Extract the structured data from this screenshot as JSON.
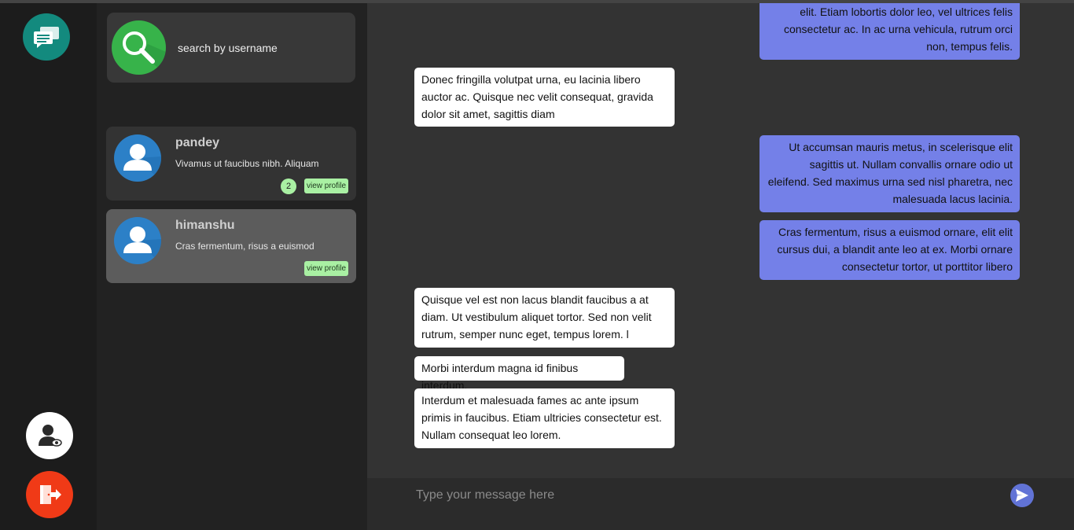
{
  "colors": {
    "accent_teal": "#138a7e",
    "search_green": "#37b34a",
    "avatar_blue": "#2c80c7",
    "badge_green": "#a9f0a3",
    "outgoing_bubble": "#7480e8",
    "logout_red": "#f03a17",
    "send_button": "#6173d6"
  },
  "rail": {
    "chat_icon": "chat-bubbles-icon",
    "profile_icon": "user-view-icon",
    "logout_icon": "logout-door-icon"
  },
  "search": {
    "placeholder": "search by username",
    "icon": "search-icon"
  },
  "contacts": [
    {
      "name": "pandey",
      "last_message": "Vivamus ut faucibus nibh. Aliquam",
      "unread": "2",
      "view_label": "view profile",
      "active": false
    },
    {
      "name": "himanshu",
      "last_message": "Cras fermentum, risus a euismod",
      "unread": "",
      "view_label": "view profile",
      "active": true
    }
  ],
  "messages": [
    {
      "direction": "out",
      "text": "elit. Etiam lobortis dolor leo, vel ultrices felis consectetur ac. In ac urna vehicula, rutrum orci non, tempus felis."
    },
    {
      "direction": "in",
      "text": "Donec fringilla volutpat urna, eu lacinia libero auctor ac. Quisque nec velit consequat, gravida dolor sit amet, sagittis diam"
    },
    {
      "direction": "out",
      "text": "Ut accumsan mauris metus, in scelerisque elit sagittis ut. Nullam convallis ornare odio ut eleifend. Sed maximus urna sed nisl pharetra, nec malesuada lacus lacinia."
    },
    {
      "direction": "out",
      "text": "Cras fermentum, risus a euismod ornare, elit elit cursus dui, a blandit ante leo at ex. Morbi ornare consectetur tortor, ut porttitor libero"
    },
    {
      "direction": "in",
      "text": "Quisque vel est non lacus blandit faucibus a at diam. Ut vestibulum aliquet tortor. Sed non velit rutrum, semper nunc eget, tempus lorem. l"
    },
    {
      "direction": "in",
      "text": "Morbi interdum magna id finibus interdum."
    },
    {
      "direction": "in",
      "text": "Interdum et malesuada fames ac ante ipsum primis in faucibus. Etiam ultricies consectetur est. Nullam consequat leo lorem."
    }
  ],
  "composer": {
    "placeholder": "Type your message here",
    "send_icon": "send-icon"
  }
}
